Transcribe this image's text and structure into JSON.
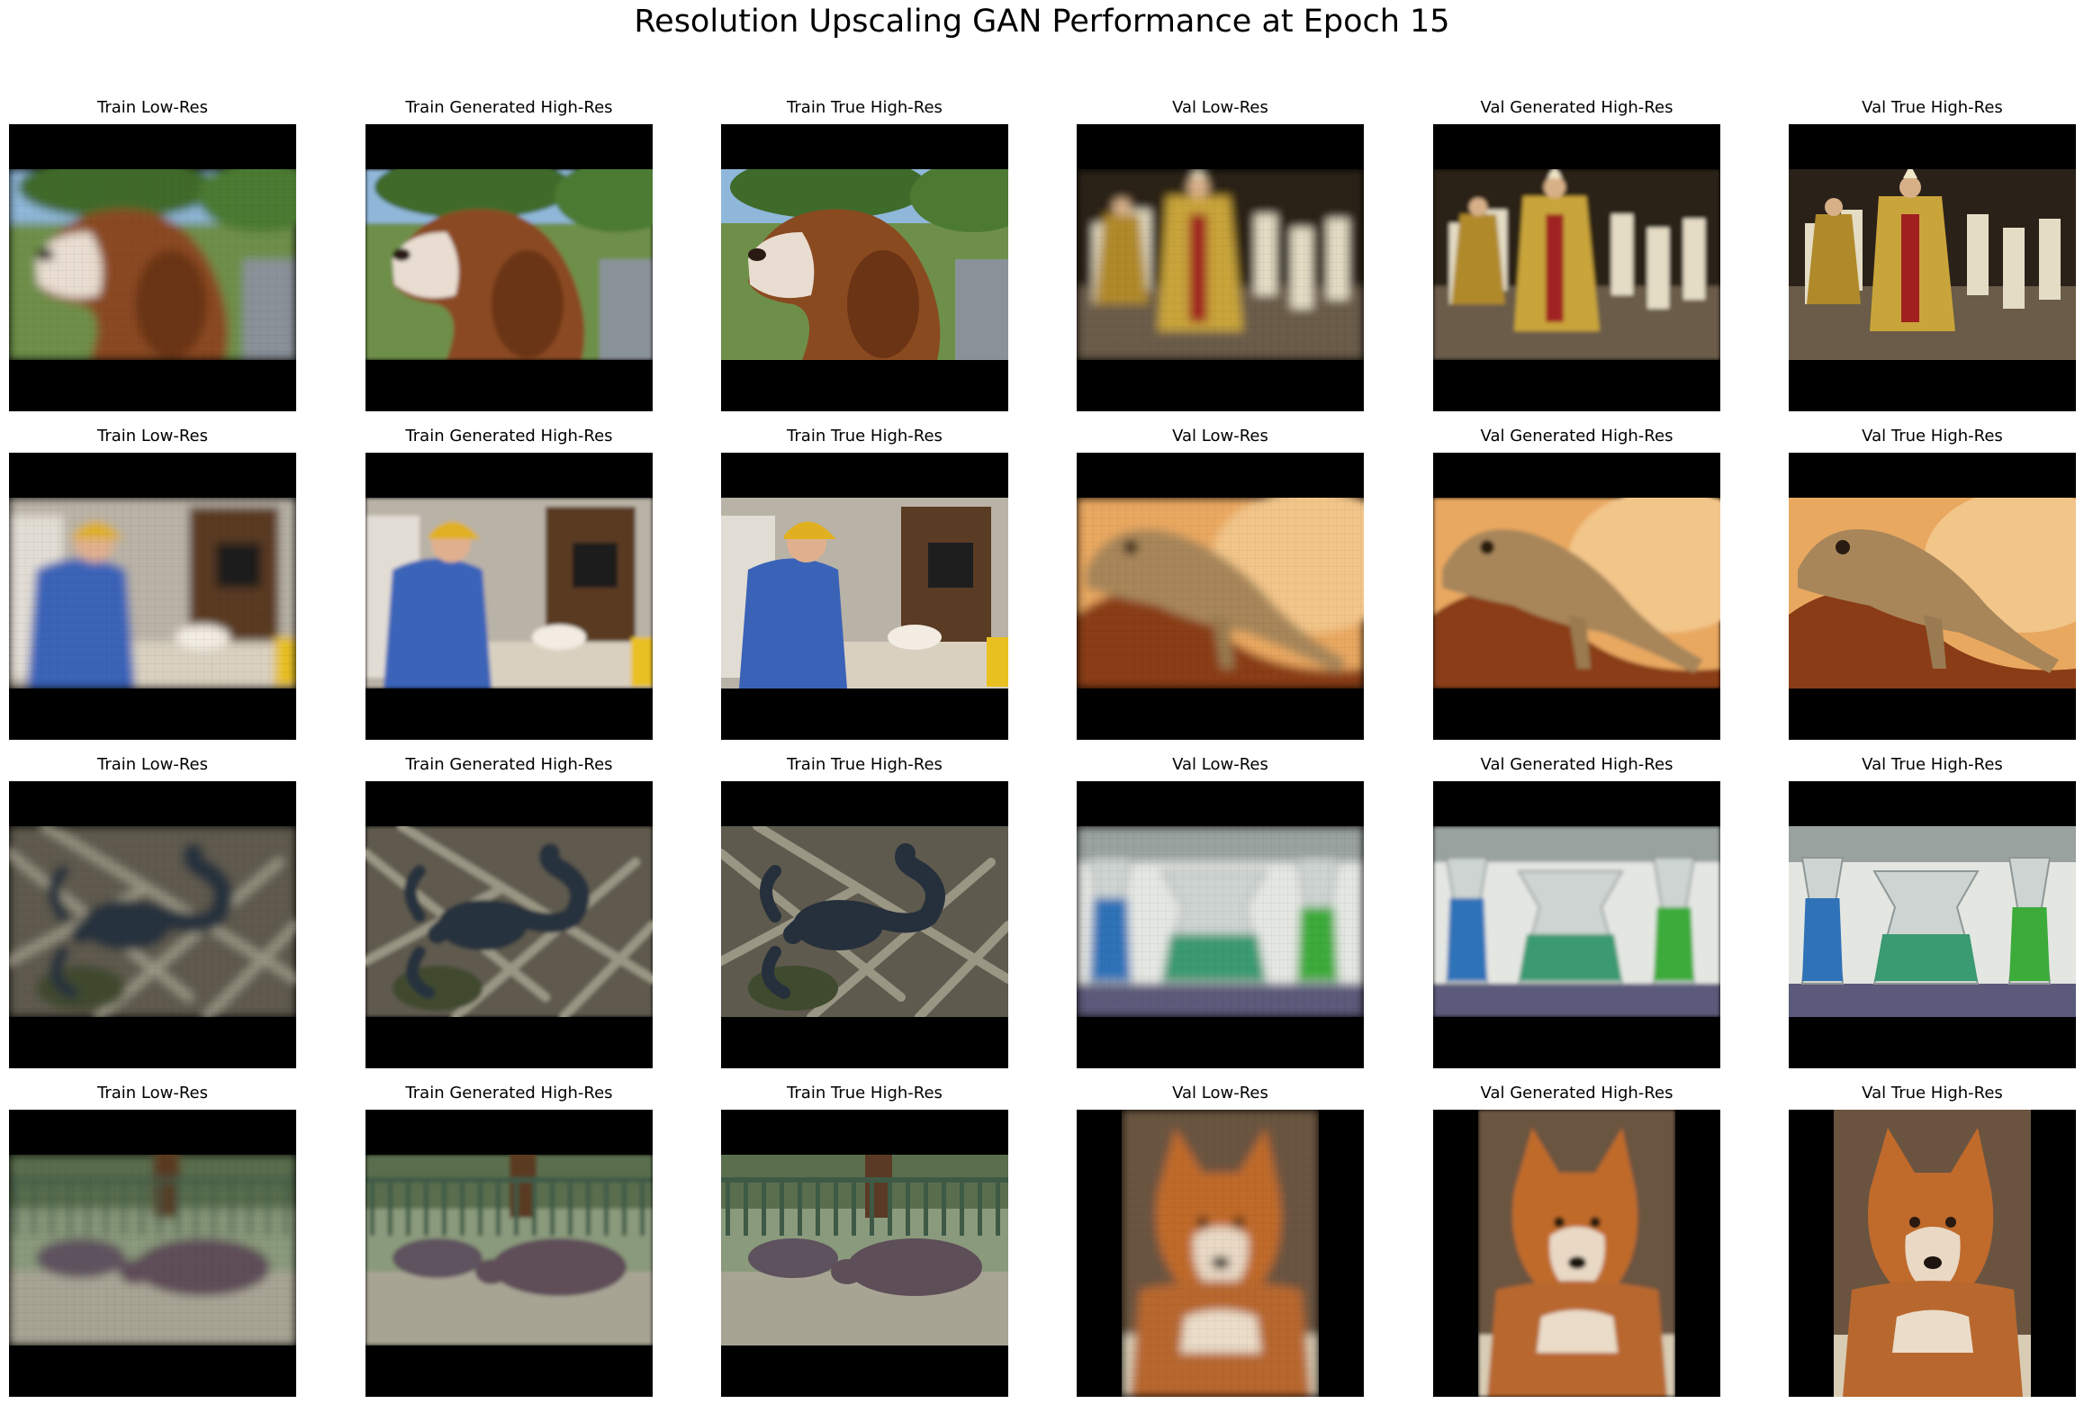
{
  "title": "Resolution Upscaling GAN Performance at Epoch 15",
  "columns": [
    "Train Low-Res",
    "Train Generated High-Res",
    "Train True High-Res",
    "Val Low-Res",
    "Val Generated High-Res",
    "Val True High-Res"
  ],
  "rows": [
    {
      "train_subject": "dog",
      "val_subject": "procession",
      "train_layout": "landscape",
      "val_layout": "landscape"
    },
    {
      "train_subject": "person-cutting-cake",
      "val_subject": "lizard",
      "train_layout": "landscape",
      "val_layout": "landscape"
    },
    {
      "train_subject": "scorpion",
      "val_subject": "sand-vases",
      "train_layout": "landscape",
      "val_layout": "landscape"
    },
    {
      "train_subject": "hippos",
      "val_subject": "wild-dog",
      "train_layout": "landscape",
      "val_layout": "portrait"
    }
  ]
}
